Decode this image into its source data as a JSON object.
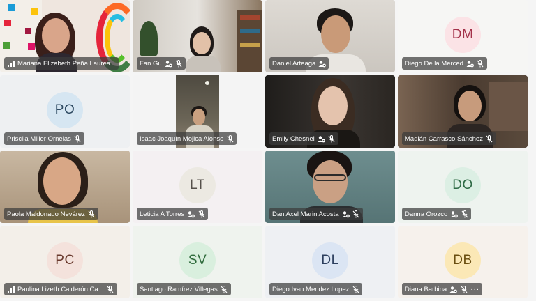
{
  "participants": [
    {
      "name": "Mariana Elizabeth Peña Laurea...",
      "initials": "",
      "signal": true,
      "badge": false,
      "muted": false,
      "video": true
    },
    {
      "name": "Fan Gu",
      "initials": "",
      "signal": false,
      "badge": true,
      "muted": true,
      "video": true
    },
    {
      "name": "Daniel Arteaga",
      "initials": "",
      "signal": false,
      "badge": true,
      "muted": false,
      "video": true
    },
    {
      "name": "Diego De la Merced",
      "initials": "DM",
      "signal": false,
      "badge": true,
      "muted": true,
      "video": false
    },
    {
      "name": "Priscila Miller Ornelas",
      "initials": "PO",
      "signal": false,
      "badge": false,
      "muted": true,
      "video": false
    },
    {
      "name": "Isaac Joaquín Mojica Alonso",
      "initials": "",
      "signal": false,
      "badge": false,
      "muted": true,
      "video": true
    },
    {
      "name": "Emily Chesnel",
      "initials": "",
      "signal": false,
      "badge": true,
      "muted": true,
      "video": true
    },
    {
      "name": "Madián Carrasco Sánchez",
      "initials": "",
      "signal": false,
      "badge": false,
      "muted": true,
      "video": true
    },
    {
      "name": "Paola Maldonado Nevárez",
      "initials": "",
      "signal": false,
      "badge": false,
      "muted": true,
      "video": true
    },
    {
      "name": "Leticia A Torres",
      "initials": "LT",
      "signal": false,
      "badge": true,
      "muted": true,
      "video": false
    },
    {
      "name": "Dan Axel Marin Acosta",
      "initials": "",
      "signal": false,
      "badge": true,
      "muted": true,
      "video": true
    },
    {
      "name": "Danna Orozco",
      "initials": "DO",
      "signal": false,
      "badge": true,
      "muted": true,
      "video": false
    },
    {
      "name": "Paulina Lizeth Calderón Ca...",
      "initials": "PC",
      "signal": true,
      "badge": false,
      "muted": true,
      "video": false
    },
    {
      "name": "Santiago Ramírez Villegas",
      "initials": "SV",
      "signal": false,
      "badge": false,
      "muted": true,
      "video": false
    },
    {
      "name": "Diego Ivan Mendez Lopez",
      "initials": "DL",
      "signal": false,
      "badge": false,
      "muted": true,
      "video": false
    },
    {
      "name": "Diana Barbina",
      "initials": "DB",
      "signal": false,
      "badge": true,
      "muted": true,
      "video": false,
      "more": true
    }
  ],
  "more_label": "···",
  "colors": {
    "label_bg": "#3c3c3cb8",
    "DM": {
      "bg": "#fbe3e6",
      "fg": "#a3324a",
      "tile": "#f6f6f4"
    },
    "PO": {
      "bg": "#d6e6f2",
      "fg": "#2e4a62",
      "tile": "#eef0f2"
    },
    "LT": {
      "bg": "#ece9e2",
      "fg": "#55504a",
      "tile": "#f4f0f2"
    },
    "DO": {
      "bg": "#dcefe4",
      "fg": "#2e6a45",
      "tile": "#eef3ef"
    },
    "PC": {
      "bg": "#f4e2dc",
      "fg": "#6a3a2e",
      "tile": "#f3efe9"
    },
    "SV": {
      "bg": "#d9efde",
      "fg": "#2f6b3c",
      "tile": "#eff3ee"
    },
    "DL": {
      "bg": "#dbe5f3",
      "fg": "#2c3f5e",
      "tile": "#eef0f3"
    },
    "DB": {
      "bg": "#fbe8b6",
      "fg": "#6a4e10",
      "tile": "#f6f1ec"
    }
  }
}
